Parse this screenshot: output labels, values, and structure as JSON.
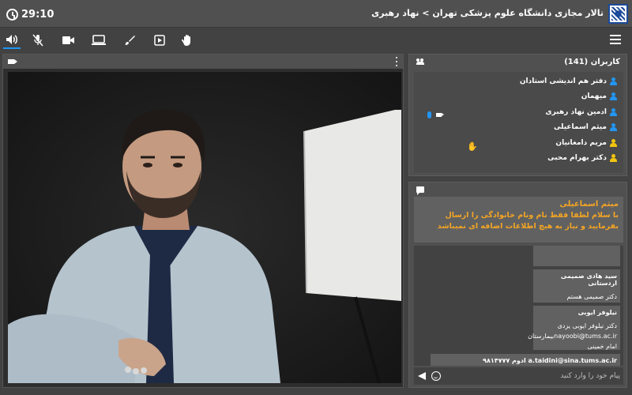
{
  "header": {
    "timer": "29:10",
    "title": "تالار مجازی دانشگاه علوم پزشکی تهران > نهاد رهبری"
  },
  "toolbar": {
    "icons": [
      "speaker-icon",
      "mic-off-icon",
      "camera-icon",
      "screen-share-icon",
      "whiteboard-icon",
      "presentation-icon",
      "raise-hand-icon",
      "menu-icon"
    ],
    "active": "speaker-icon",
    "accent": "#2196f3"
  },
  "users": {
    "title": "کاربران (141)",
    "items": [
      {
        "name": "دفتر هم اندیشی استادان",
        "color": "blue"
      },
      {
        "name": "میهمان",
        "color": "blue"
      },
      {
        "name": "ادمین نهاد رهبری",
        "color": "blue"
      },
      {
        "name": "میثم اسماعیلی",
        "color": "blue"
      },
      {
        "name": "مریم دامغانیان",
        "color": "yellow"
      },
      {
        "name": "دکتر بهرام محبی",
        "color": "yellow"
      }
    ]
  },
  "chat": {
    "pinned": {
      "author": "میثم اسماعیلی",
      "text": "با سلام لطفا فقط نام ونام خانوادگی را ارسال بفرمایید و نیاز به هیچ اطلاعات اضافه ای نمیباشد"
    },
    "messages": [
      {
        "author": "سید هادی صمیمی اردستانی",
        "text": "دکتر صمیمی هستم"
      },
      {
        "author": "نیلوفر ایوبی",
        "text": "دکتر نیلوفر ایوبی یزدی\nnayoobi@tums.ac.irبیمارستان امام خمینی"
      },
      {
        "author": "a.taidini@sina.tums.ac.ir ادوم ۹۸۱۴۷۷۷",
        "text": ""
      }
    ],
    "input_placeholder": "پیام خود را وارد کنید"
  },
  "colors": {
    "background": "#424242",
    "panel": "#505050",
    "pinned_text": "#f5a623",
    "user_blue": "#2196f3",
    "user_yellow": "#f1c40f"
  }
}
